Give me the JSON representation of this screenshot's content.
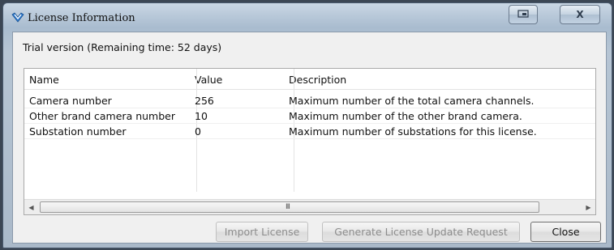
{
  "window": {
    "title": "License Information",
    "icon": "app-logo-icon",
    "controls": {
      "restore_icon": "restore-icon",
      "close_icon": "close-icon",
      "close_glyph": "X"
    }
  },
  "trial_text": "Trial version (Remaining time: 52 days)",
  "table": {
    "columns": [
      "Name",
      "Value",
      "Description"
    ],
    "rows": [
      {
        "name": "Camera number",
        "value": "256",
        "description": "Maximum number of the total camera channels."
      },
      {
        "name": "Other brand camera number",
        "value": "10",
        "description": "Maximum number of the other brand camera."
      },
      {
        "name": "Substation number",
        "value": "0",
        "description": "Maximum number of substations for this license."
      }
    ],
    "scrollbar": {
      "left_icon": "arrow-left-icon",
      "right_icon": "arrow-right-icon",
      "grip": "III"
    }
  },
  "buttons": {
    "import": "Import License",
    "generate": "Generate License Update Request",
    "close": "Close"
  },
  "colors": {
    "titlebar": "#b6c5d4",
    "client_bg": "#f0f0f0",
    "accent": "#2f7bd1"
  }
}
